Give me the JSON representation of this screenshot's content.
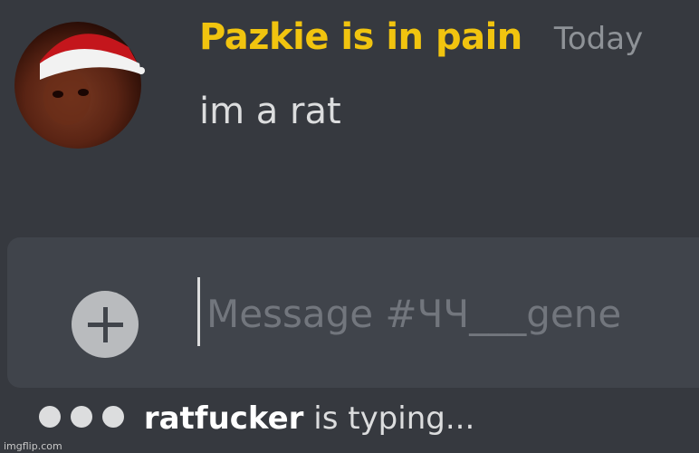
{
  "message": {
    "author": "Pazkie is in pain",
    "timestamp": "Today",
    "content": "im a rat",
    "author_color": "#f1c40f",
    "avatar_icon": "avatar-santa-hat"
  },
  "composer": {
    "placeholder": "Message #ЧЧ___gene",
    "attach_icon": "plus-circle-icon"
  },
  "typing_indicator": {
    "user": "ratfucker",
    "text": "is typing..."
  },
  "watermark": "imgflip.com",
  "colors": {
    "background": "#36393f",
    "composer": "#40444b",
    "username": "#f1c40f",
    "muted": "#8e9297"
  }
}
